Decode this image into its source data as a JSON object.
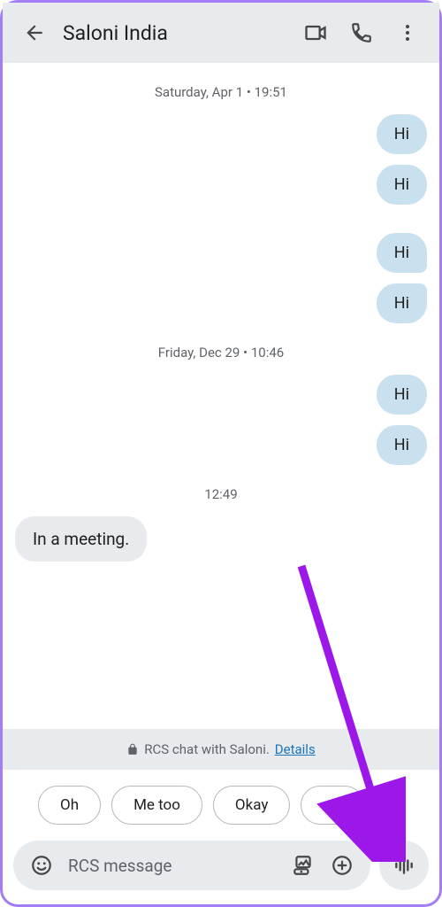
{
  "header": {
    "title": "Saloni India"
  },
  "timestamps": {
    "t1": "Saturday, Apr 1 • 19:51",
    "t2": "Friday, Dec 29 • 10:46",
    "t3": "12:49"
  },
  "messages": {
    "out1": "Hi",
    "out2": "Hi",
    "out3": "Hi",
    "out4": "Hi",
    "out5": "Hi",
    "out6": "Hi",
    "in1": "In a meeting."
  },
  "rcs": {
    "text": "RCS chat with Saloni.",
    "details": "Details"
  },
  "chips": {
    "c1": "Oh",
    "c2": "Me too",
    "c3": "Okay"
  },
  "compose": {
    "placeholder": "RCS message"
  }
}
